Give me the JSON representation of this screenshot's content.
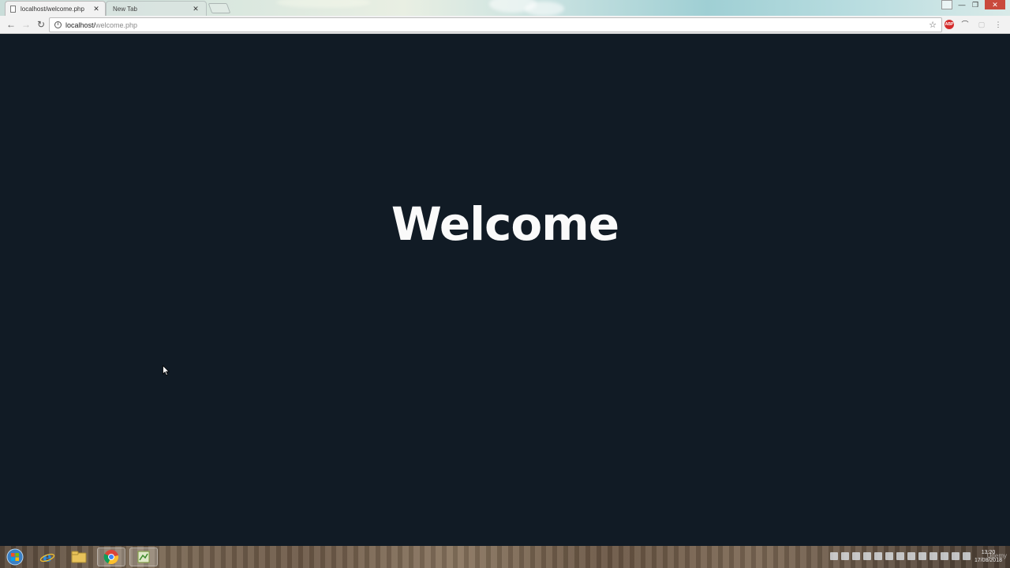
{
  "browser": {
    "tabs": [
      {
        "label": "localhost/welcome.php",
        "active": true
      },
      {
        "label": "New Tab",
        "active": false
      }
    ],
    "close_glyph": "✕",
    "url_host": "localhost/",
    "url_path": "welcome.php",
    "nav": {
      "back": "←",
      "forward": "→",
      "reload": "↻"
    },
    "star": "☆",
    "extensions": {
      "abp": "ABP",
      "other": "⌒",
      "menu": "⋮"
    },
    "window_controls": {
      "minimize": "—",
      "maximize": "❐",
      "close": "✕"
    }
  },
  "page": {
    "heading": "Welcome"
  },
  "colors": {
    "page_background": "#111b25",
    "heading": "#fafafa"
  },
  "taskbar": {
    "items": [
      "start-orb-icon",
      "internet-explorer-icon",
      "file-explorer-icon",
      "chrome-icon",
      "editor-icon"
    ],
    "clock_time": "13:20",
    "clock_date": "17/08/2018",
    "watermark": "Udemy"
  }
}
